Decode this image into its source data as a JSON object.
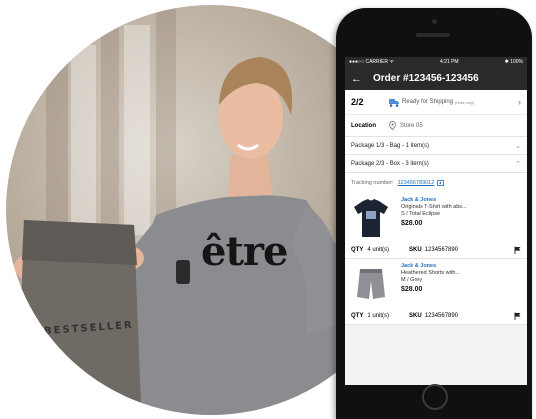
{
  "photo": {
    "bag_brand": "BESTSELLER",
    "shirt_print": "être"
  },
  "phone": {
    "status": {
      "carrier": "●●●○○ CARRIER ᯤ",
      "time": "4:21 PM",
      "battery": "✱ 100%"
    },
    "header": {
      "back_icon": "arrow-left-icon",
      "title": "Order #123456-123456"
    },
    "summary": {
      "count": "2/2",
      "status_text": "Ready for Shipping",
      "status_note": "(read only)",
      "location_label": "Location",
      "location_value": "Store 05"
    },
    "packages": [
      {
        "label": "Package 1/3 - Bag - 1 item(s)",
        "expanded": false
      },
      {
        "label": "Package 2/3 - Box - 3 item(s)",
        "expanded": true
      }
    ],
    "tracking": {
      "label": "Tracking number:",
      "value": "123456789012"
    },
    "items": [
      {
        "brand": "Jack & Jones",
        "name": "Originals T-Shirt with abs...",
        "variant": "S / Total Eclipse",
        "price": "$28.00",
        "qty_label": "QTY",
        "qty": "4 unit(s)",
        "sku_label": "SKU",
        "sku": "1234567890"
      },
      {
        "brand": "Jack & Jones",
        "name": "Heathered Shorts with...",
        "variant": "M / Grey",
        "price": "$28.00",
        "qty_label": "QTY",
        "qty": "1 unit(s)",
        "sku_label": "SKU",
        "sku": "1234567890"
      }
    ]
  },
  "colors": {
    "link": "#1e6fc2",
    "appbar": "#2a2a2a"
  }
}
